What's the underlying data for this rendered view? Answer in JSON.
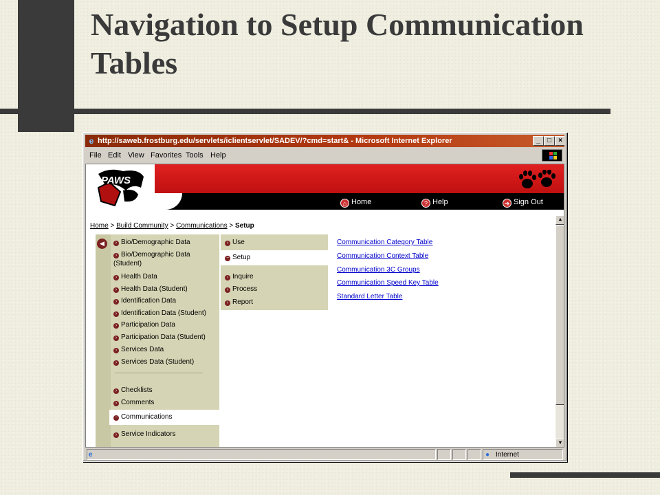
{
  "slide": {
    "title": "Navigation to Setup Communication Tables"
  },
  "browser": {
    "title": "http://saweb.frostburg.edu/servlets/iclientservlet/SADEV/?cmd=start& - Microsoft Internet Explorer",
    "window_buttons": {
      "minimize": "_",
      "maximize": "□",
      "close": "×"
    },
    "menu": [
      "File",
      "Edit",
      "View",
      "Favorites",
      "Tools",
      "Help"
    ],
    "status": {
      "zone": "Internet"
    }
  },
  "header": {
    "logo_text": "PAWS",
    "nav": [
      {
        "label": "Home",
        "icon": "home-icon"
      },
      {
        "label": "Help",
        "icon": "help-icon"
      },
      {
        "label": "Sign Out",
        "icon": "sign-out-icon"
      }
    ]
  },
  "breadcrumb": {
    "items": [
      "Home",
      "Build Community",
      "Communications"
    ],
    "separator": ">",
    "current": "Setup"
  },
  "left_menu": {
    "items": [
      "Bio/Demographic Data",
      "Bio/Demographic Data (Student)",
      "Health Data",
      "Health Data (Student)",
      "Identification Data",
      "Identification Data (Student)",
      "Participation Data",
      "Participation Data (Student)",
      "Services Data",
      "Services Data (Student)"
    ],
    "items2": [
      "Checklists",
      "Comments"
    ],
    "selected": "Communications",
    "items3": [
      "Service Indicators"
    ]
  },
  "mid_menu": {
    "items_top": [
      "Use"
    ],
    "selected": "Setup",
    "items_bottom": [
      "Inquire",
      "Process",
      "Report"
    ]
  },
  "links": [
    "Communication Category Table",
    "Communication Context Table",
    "Communication 3C Groups",
    "Communication Speed Key Table",
    "Standard Letter Table"
  ],
  "colors": {
    "title_bar": "#a8330e",
    "banner_red": "#d41818",
    "panel_olive": "#d5d4b4",
    "link_blue": "#0000cc",
    "slide_dark": "#3a3a3a"
  }
}
